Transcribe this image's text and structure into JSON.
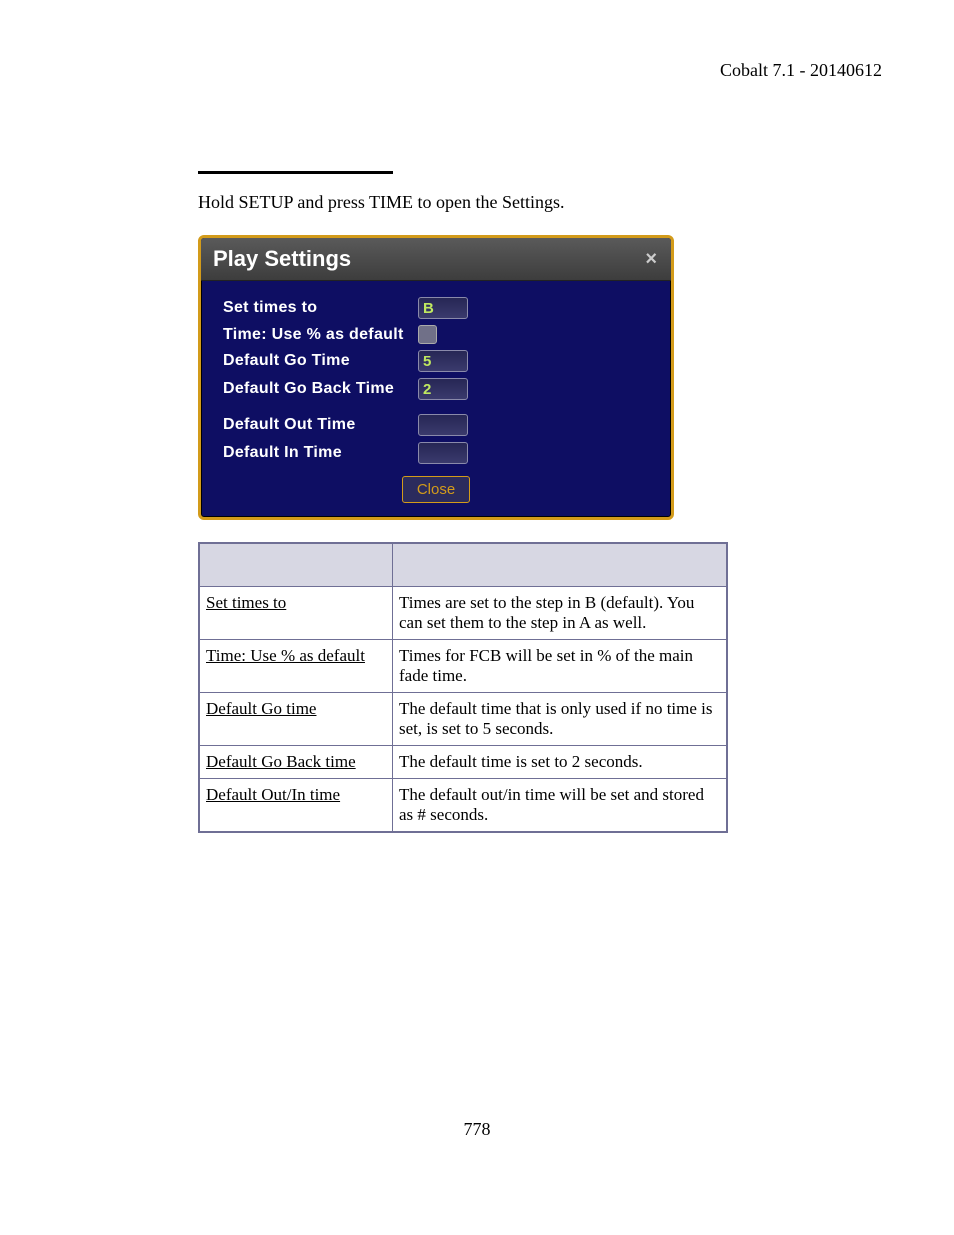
{
  "header": {
    "version": "Cobalt 7.1 - 20140612"
  },
  "intro": "Hold SETUP and press TIME to open the Settings.",
  "dialog": {
    "title": "Play Settings",
    "close_x": "×",
    "rows": {
      "set_times_to": {
        "label": "Set times to",
        "value": "B"
      },
      "use_percent": {
        "label": "Time: Use % as default"
      },
      "go_time": {
        "label": "Default Go Time",
        "value": "5"
      },
      "go_back": {
        "label": "Default Go Back Time",
        "value": "2"
      },
      "out_time": {
        "label": "Default Out Time",
        "value": ""
      },
      "in_time": {
        "label": "Default In Time",
        "value": ""
      }
    },
    "close_label": "Close"
  },
  "table": {
    "rows": [
      {
        "name": "Set times to",
        "desc": "Times are set to the step in B (default). You can set them to the step in A as well."
      },
      {
        "name": "Time: Use % as default",
        "desc": "Times for FCB will be set in % of the main fade time."
      },
      {
        "name": "Default Go time",
        "desc": "The default time that is only used if no time is set, is set to 5 seconds."
      },
      {
        "name": "Default Go Back time",
        "desc": "The default time is set to 2 seconds."
      },
      {
        "name": "Default Out/In time",
        "desc": "The default out/in time will be set and stored as # seconds."
      }
    ]
  },
  "page_number": "778"
}
